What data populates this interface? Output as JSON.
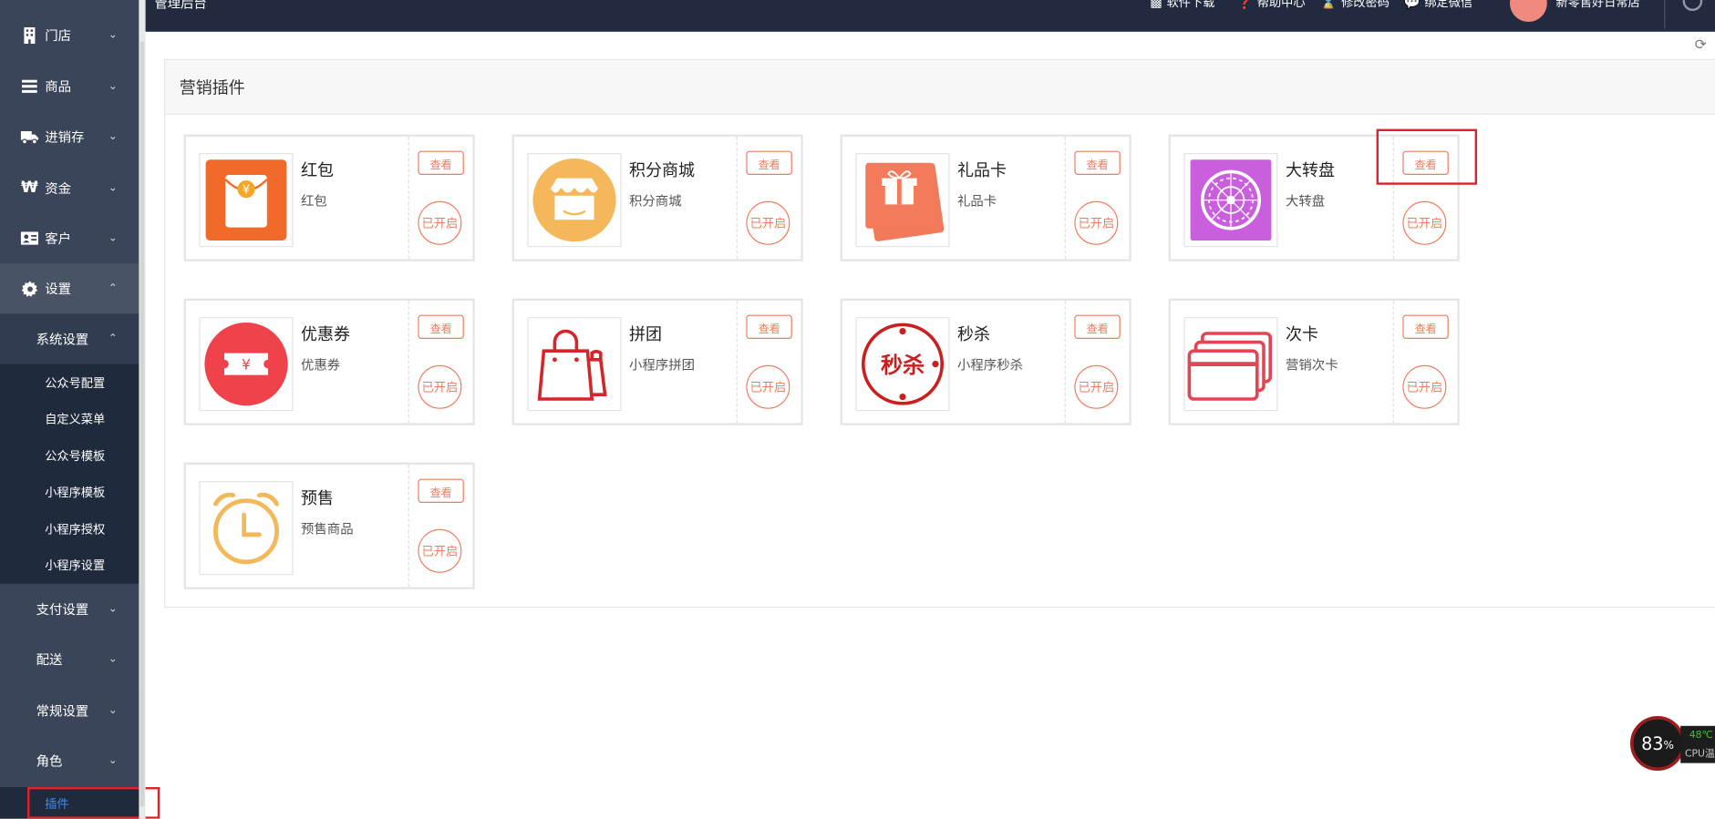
{
  "sidebar": {
    "main_items": [
      {
        "label": "门店",
        "icon": "building-icon"
      },
      {
        "label": "商品",
        "icon": "list-icon"
      },
      {
        "label": "进销存",
        "icon": "truck-icon"
      },
      {
        "label": "资金",
        "icon": "won-icon"
      },
      {
        "label": "客户",
        "icon": "id-card-icon"
      },
      {
        "label": "设置",
        "icon": "gear-icon"
      }
    ],
    "system_settings": "系统设置",
    "leaves": [
      "公众号配置",
      "自定义菜单",
      "公众号模板",
      "小程序模板",
      "小程序授权",
      "小程序设置"
    ],
    "groups": [
      "支付设置",
      "配送",
      "常规设置",
      "角色"
    ],
    "plugin_leaf": "插件"
  },
  "topbar": {
    "title": "管理后台",
    "links": [
      "软件下载",
      "帮助中心",
      "修改密码",
      "绑定微信"
    ],
    "store_name": "新零售好日常店"
  },
  "panel": {
    "title": "营销插件"
  },
  "plugins": [
    {
      "name": "红包",
      "desc": "红包",
      "view": "查看",
      "status": "已开启"
    },
    {
      "name": "积分商城",
      "desc": "积分商城",
      "view": "查看",
      "status": "已开启"
    },
    {
      "name": "礼品卡",
      "desc": "礼品卡",
      "view": "查看",
      "status": "已开启"
    },
    {
      "name": "大转盘",
      "desc": "大转盘",
      "view": "查看",
      "status": "已开启"
    },
    {
      "name": "优惠券",
      "desc": "优惠券",
      "view": "查看",
      "status": "已开启"
    },
    {
      "name": "拼团",
      "desc": "小程序拼团",
      "view": "查看",
      "status": "已开启"
    },
    {
      "name": "秒杀",
      "desc": "小程序秒杀",
      "view": "查看",
      "status": "已开启"
    },
    {
      "name": "次卡",
      "desc": "营销次卡",
      "view": "查看",
      "status": "已开启"
    },
    {
      "name": "预售",
      "desc": "预售商品",
      "view": "查看",
      "status": "已开启"
    }
  ],
  "icon_text": {
    "yen": "¥",
    "seckill": "秒杀"
  },
  "cpu_widget": {
    "usage": "83",
    "unit": "%",
    "temp": "48℃",
    "label": "CPU温"
  },
  "colors": {
    "sidebar": "#3a4559",
    "topbar": "#212a3f",
    "accent": "#f07b5c",
    "highlight": "#e0202a",
    "active_link": "#3d8af7"
  }
}
